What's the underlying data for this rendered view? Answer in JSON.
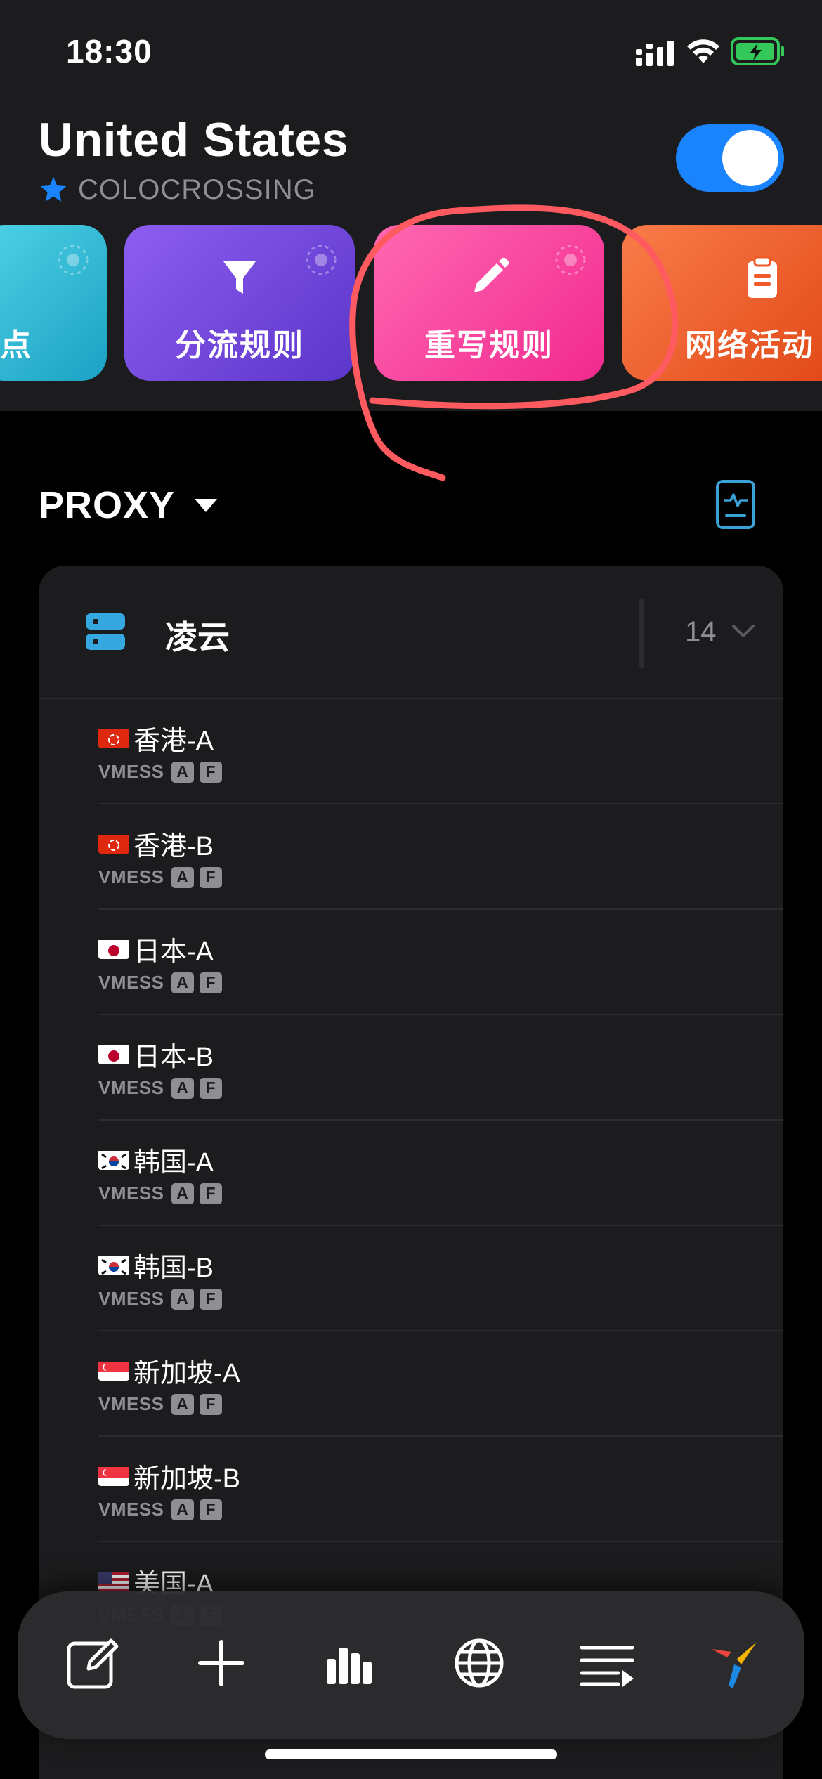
{
  "status_bar": {
    "time": "18:30"
  },
  "header": {
    "title": "United States",
    "subtitle": "COLOCROSSING",
    "vpn_enabled": true
  },
  "cards": [
    {
      "label": "点",
      "icon": "nodes-icon",
      "color": "#21b4d3"
    },
    {
      "label": "分流规则",
      "icon": "filter-icon",
      "color": "#7548e0"
    },
    {
      "label": "重写规则",
      "icon": "pencil-icon",
      "color": "#f7409e"
    },
    {
      "label": "网络活动",
      "icon": "clipboard-icon",
      "color": "#f06030"
    }
  ],
  "section": {
    "title": "PROXY"
  },
  "group": {
    "name": "凌云",
    "count": "14",
    "nodes": [
      {
        "name": "香港-A",
        "flag": "hk",
        "protocol": "VMESS",
        "tags": [
          "A",
          "F"
        ]
      },
      {
        "name": "香港-B",
        "flag": "hk",
        "protocol": "VMESS",
        "tags": [
          "A",
          "F"
        ]
      },
      {
        "name": "日本-A",
        "flag": "jp",
        "protocol": "VMESS",
        "tags": [
          "A",
          "F"
        ]
      },
      {
        "name": "日本-B",
        "flag": "jp",
        "protocol": "VMESS",
        "tags": [
          "A",
          "F"
        ]
      },
      {
        "name": "韩国-A",
        "flag": "kr",
        "protocol": "VMESS",
        "tags": [
          "A",
          "F"
        ]
      },
      {
        "name": "韩国-B",
        "flag": "kr",
        "protocol": "VMESS",
        "tags": [
          "A",
          "F"
        ]
      },
      {
        "name": "新加坡-A",
        "flag": "sg",
        "protocol": "VMESS",
        "tags": [
          "A",
          "F"
        ]
      },
      {
        "name": "新加坡-B",
        "flag": "sg",
        "protocol": "VMESS",
        "tags": [
          "A",
          "F"
        ]
      },
      {
        "name": "美国-A",
        "flag": "us",
        "protocol": "VMESS",
        "tags": [
          "A",
          "F"
        ]
      }
    ]
  },
  "tabbar": {
    "items": [
      {
        "icon": "edit-icon"
      },
      {
        "icon": "plus-icon"
      },
      {
        "icon": "stats-icon"
      },
      {
        "icon": "globe-icon"
      },
      {
        "icon": "list-play-icon"
      },
      {
        "icon": "app-logo-icon"
      }
    ]
  },
  "colors": {
    "accent": "#1a84ff",
    "annotation": "#ff5a5f",
    "background": "#000000",
    "surface": "#1c1c1e"
  }
}
